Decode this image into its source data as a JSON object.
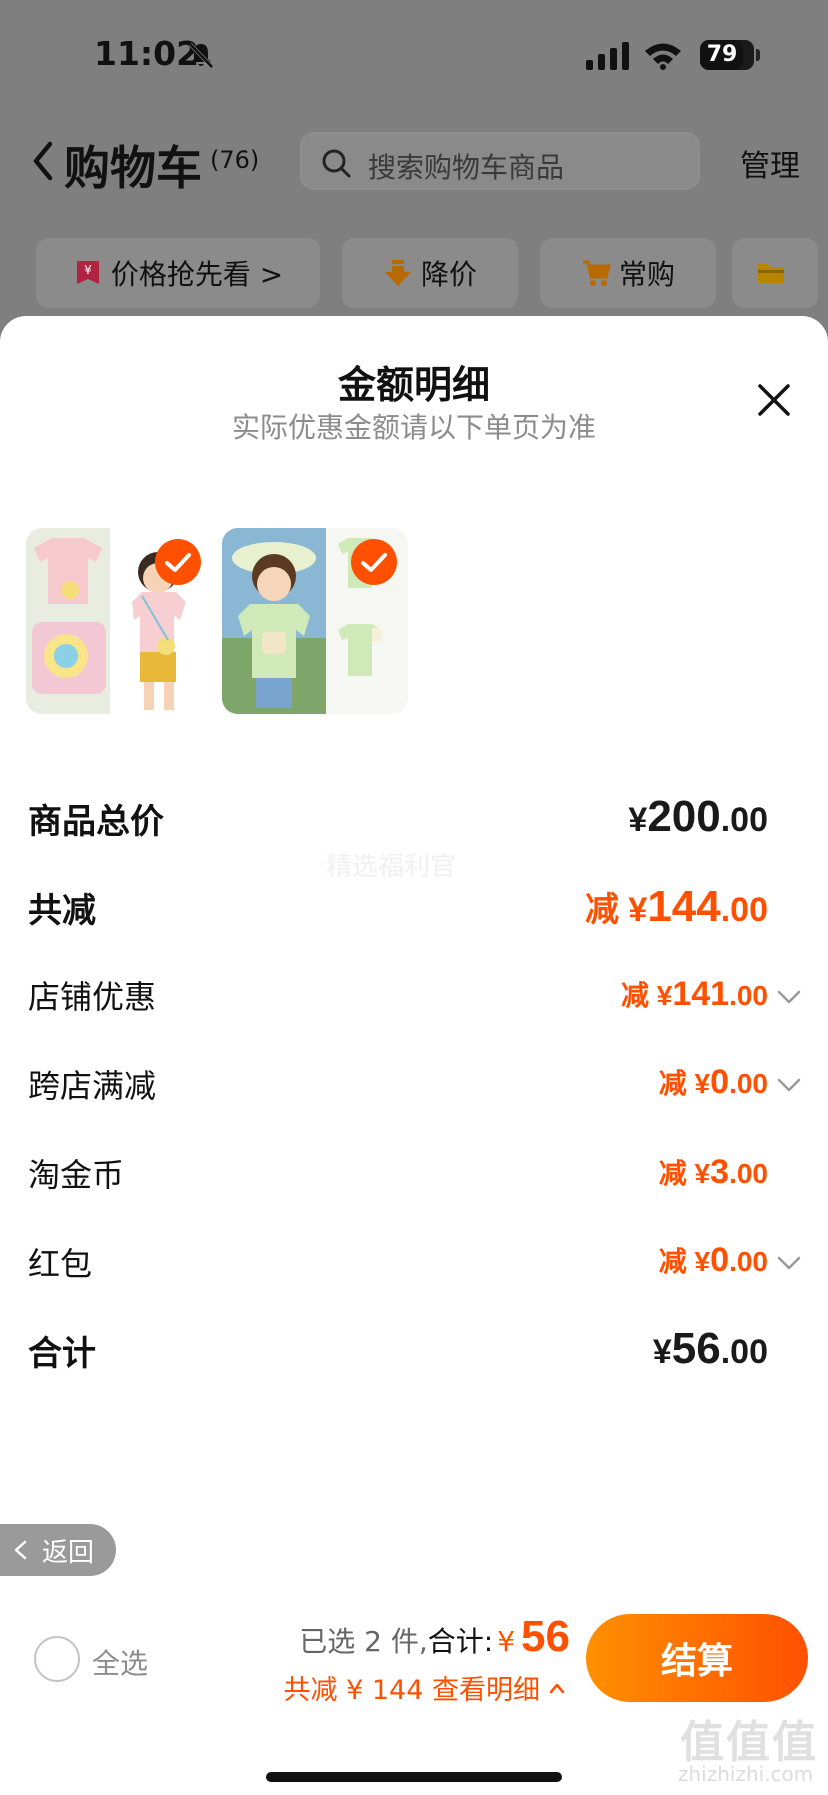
{
  "status_bar": {
    "time": "11:02",
    "battery": "79",
    "battery_level": 0.79
  },
  "header": {
    "title": "购物车",
    "count": "(76)",
    "search_placeholder": "搜索购物车商品",
    "manage_label": "管理"
  },
  "filters": [
    {
      "label": "价格抢先看 >",
      "icon": "yen-tag-icon"
    },
    {
      "label": "降价",
      "icon": "price-drop-icon"
    },
    {
      "label": "常购",
      "icon": "cart-icon"
    },
    {
      "label": "",
      "icon": "folder-icon"
    }
  ],
  "sheet": {
    "title": "金额明细",
    "subtitle": "实际优惠金额请以下单页为准",
    "watermark": "精选福利官"
  },
  "breakdown": {
    "total_price": {
      "label": "商品总价",
      "yen": "¥",
      "int": "200",
      "dec": ".00"
    },
    "total_discount": {
      "label": "共减",
      "prefix": "减 ¥",
      "int": "144",
      "dec": ".00"
    },
    "store_discount": {
      "label": "店铺优惠",
      "prefix": "减 ¥",
      "int": "141",
      "dec": ".00"
    },
    "cross_store": {
      "label": "跨店满减",
      "prefix": "减 ¥",
      "int": "0",
      "dec": ".00"
    },
    "taojin_coins": {
      "label": "淘金币",
      "prefix": "减 ¥",
      "int": "3",
      "dec": ".00"
    },
    "red_packet": {
      "label": "红包",
      "prefix": "减 ¥",
      "int": "0",
      "dec": ".00"
    },
    "grand_total": {
      "label": "合计",
      "yen": "¥",
      "int": "56",
      "dec": ".00"
    }
  },
  "back_pill": {
    "label": "返回"
  },
  "checkout": {
    "select_all": "全选",
    "selected_text": "已选 2 件,",
    "total_label": "合计:",
    "yen": "¥",
    "amount": "56",
    "discount_text": "共减 ¥ 144  查看明细",
    "button_label": "结算"
  },
  "branding": {
    "site_mark": "值值值",
    "site_url": "zhizhizhi.com"
  },
  "colors": {
    "accent": "#ff5000",
    "button_start": "#ff9000",
    "button_end": "#ff5000"
  }
}
